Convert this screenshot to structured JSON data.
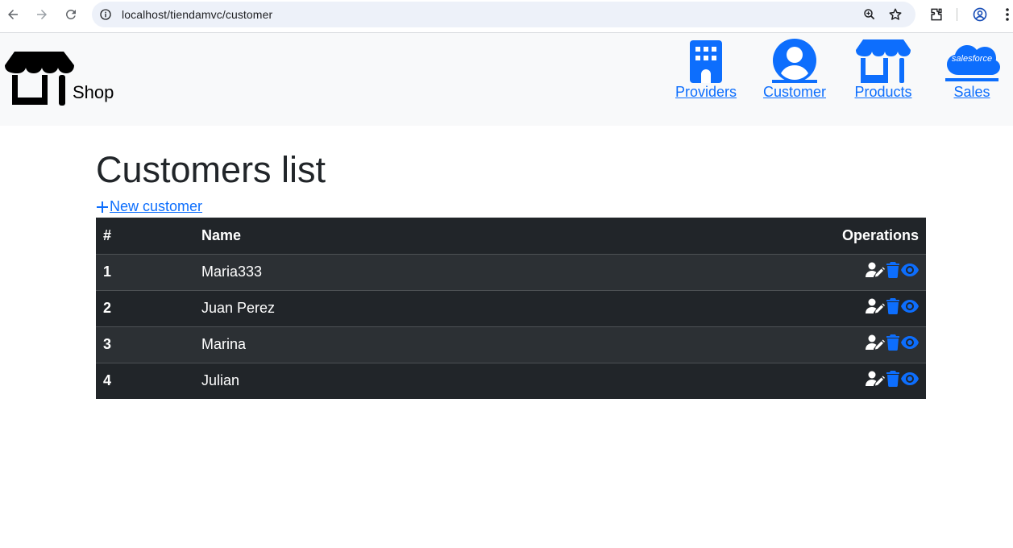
{
  "browser": {
    "url": "localhost/tiendamvc/customer"
  },
  "navbar": {
    "brand": "Shop",
    "items": [
      {
        "label": "Providers",
        "icon": "building-icon"
      },
      {
        "label": "Customer",
        "icon": "user-circle-icon"
      },
      {
        "label": "Products",
        "icon": "store-icon"
      },
      {
        "label": "Sales",
        "icon": "salesforce-cloud-icon"
      }
    ],
    "salesforce_logo_text": "salesforce"
  },
  "main": {
    "title": "Customers list",
    "new_link": "New customer",
    "table": {
      "headers": [
        "#",
        "Name",
        "Operations"
      ],
      "rows": [
        {
          "id": "1",
          "name": "Maria333"
        },
        {
          "id": "2",
          "name": "Juan Perez"
        },
        {
          "id": "3",
          "name": "Marina"
        },
        {
          "id": "4",
          "name": "Julian"
        }
      ],
      "operations": [
        "edit-user-icon",
        "trash-icon",
        "eye-icon"
      ]
    }
  },
  "colors": {
    "accent": "#0d6efd",
    "navbar_bg": "#f8f9fa",
    "table_dark": "#212529",
    "table_stripe": "#2c3034"
  }
}
